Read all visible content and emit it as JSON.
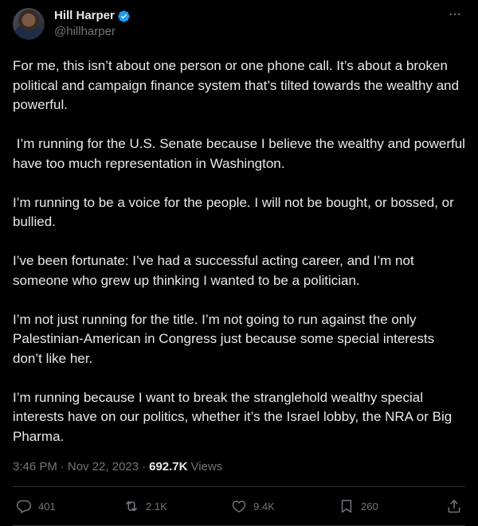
{
  "author": {
    "display_name": "Hill Harper",
    "handle": "@hillharper",
    "verified": true
  },
  "tweet": {
    "paragraphs": [
      "For me, this isn’t about one person or one phone call.  It’s about a broken political and campaign finance system that’s tilted towards the wealthy and powerful.",
      " I’m running for the U.S. Senate because I believe the wealthy and powerful have too much representation in Washington.",
      "I’m running to be a voice for the people. I will not be bought, or bossed, or bullied.",
      "I’ve been fortunate: I’ve had a successful acting career, and I’m not someone who grew up thinking I wanted to be a politician.",
      "I’m not just running for the title. I’m not going to run against the only Palestinian-American in Congress just because some special interests don’t like her.",
      "I’m running because I want to break the stranglehold wealthy special interests have on our politics, whether it’s the Israel lobby, the NRA or Big Pharma."
    ],
    "time": "3:46 PM",
    "separator": "·",
    "date": "Nov 22, 2023",
    "views_count": "692.7K",
    "views_label": "Views"
  },
  "actions": {
    "replies": "401",
    "reposts": "2.1K",
    "likes": "9.4K",
    "bookmarks": "260"
  },
  "icons": {
    "verified": "verified-badge-icon",
    "more": "more-options-icon",
    "reply": "reply-icon",
    "repost": "repost-icon",
    "like": "heart-icon",
    "bookmark": "bookmark-icon",
    "share": "share-icon"
  },
  "colors": {
    "background": "#000000",
    "text": "#e7e9ea",
    "secondary": "#71767b",
    "verified": "#1d9bf0",
    "divider": "#2f3336"
  }
}
